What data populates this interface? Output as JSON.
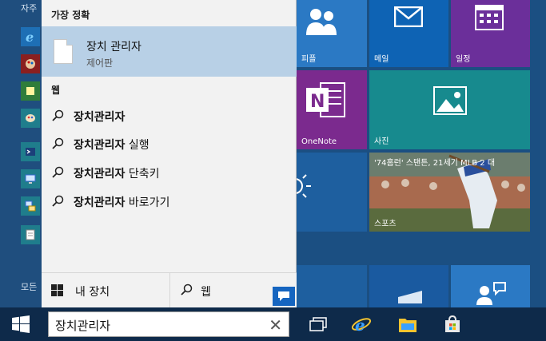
{
  "left_rail": {
    "heading": "자주",
    "all_apps": "모든"
  },
  "tiles": {
    "people_label": "피플",
    "mail_label": "메일",
    "calendar_label": "일정",
    "onenote_label": "OneNote",
    "photos_label": "사진",
    "sports_headline": "'74홈런' 스탠튼, 21세기 MLB 2 대",
    "sports_label": "스포츠"
  },
  "flyout": {
    "best_match_heading": "가장 정확",
    "best_match": {
      "title": "장치 관리자",
      "subtitle": "제어판"
    },
    "web_heading": "웹",
    "web_results": [
      {
        "bold": "장치관리자",
        "rest": ""
      },
      {
        "bold": "장치관리자",
        "rest": " 실행"
      },
      {
        "bold": "장치관리자",
        "rest": " 단축키"
      },
      {
        "bold": "장치관리자",
        "rest": " 바로가기"
      }
    ],
    "my_device_label": "내 장치",
    "web_tab_label": "웹"
  },
  "taskbar": {
    "search_value": "장치관리자",
    "search_placeholder": "",
    "clear_glyph": "✕"
  },
  "colors": {
    "accent": "#1565c0",
    "highlight": "#b8d0e6",
    "taskbar": "#0e2a4a"
  }
}
